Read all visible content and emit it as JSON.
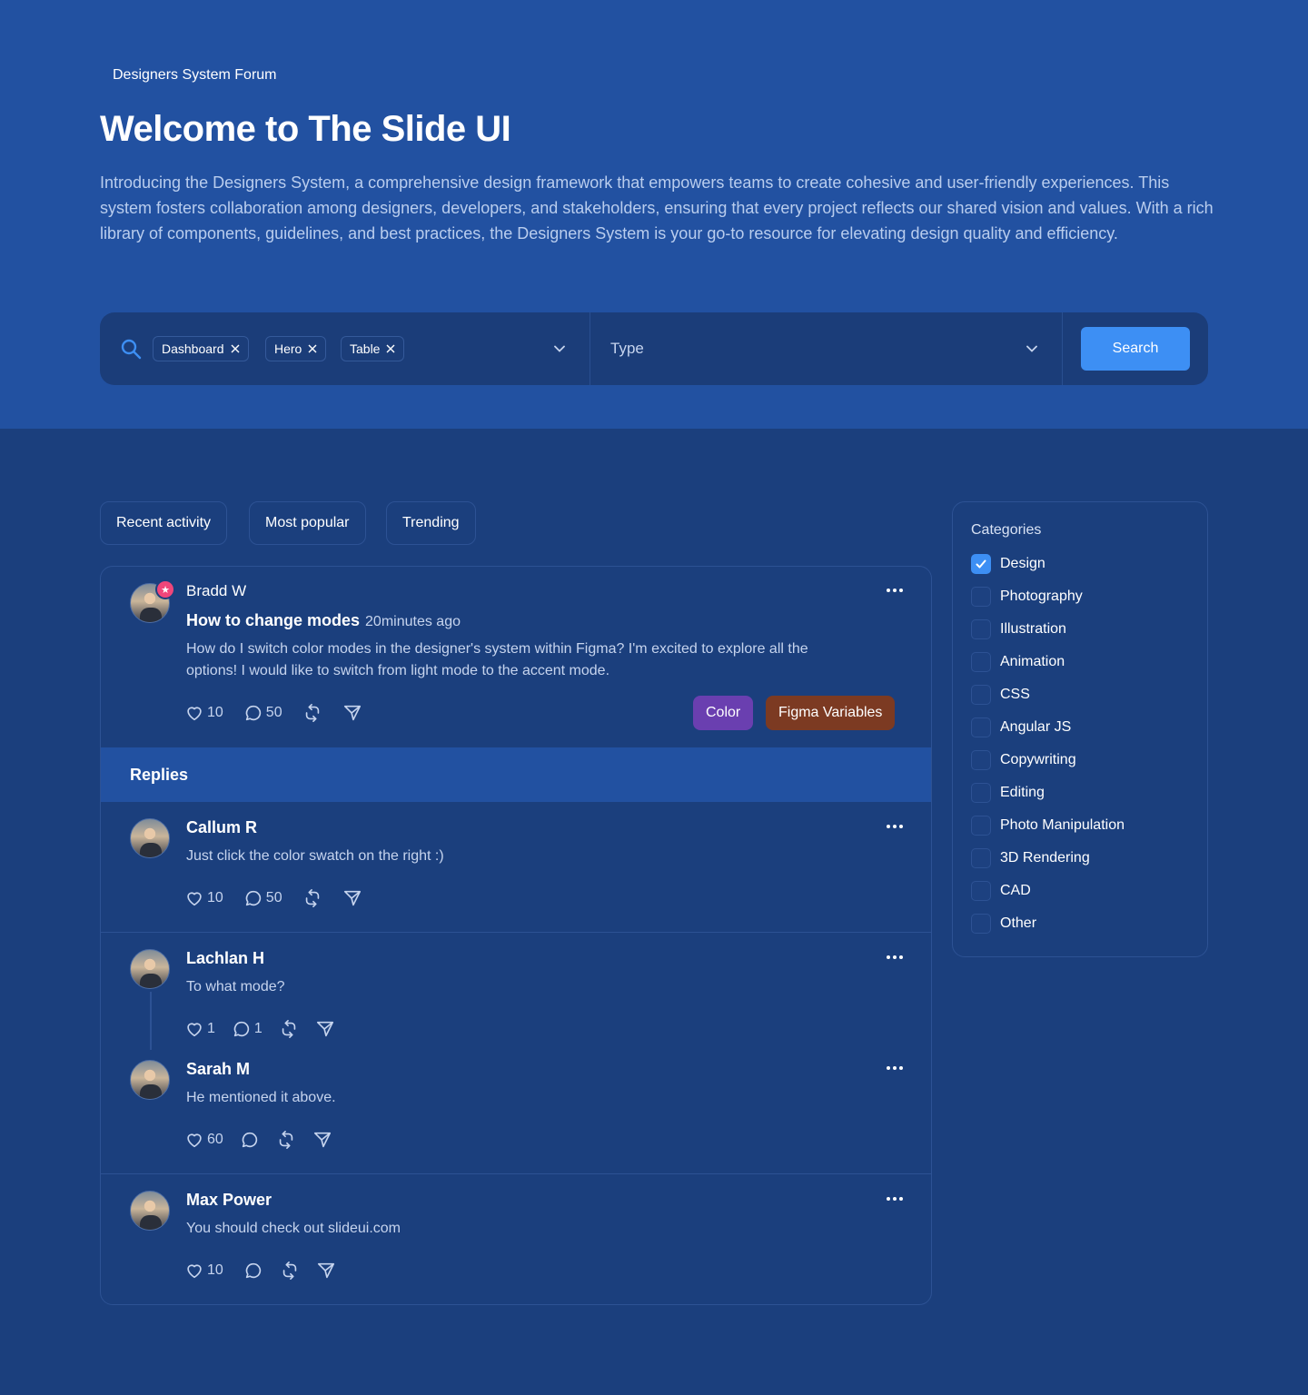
{
  "header": {
    "eyebrow": "Designers System Forum",
    "title": "Welcome to The Slide UI",
    "description": "Introducing the Designers System, a comprehensive design framework that empowers teams to create cohesive and user-friendly experiences. This system fosters collaboration among designers, developers, and stakeholders, ensuring that every project reflects our shared vision and values. With a rich library of components, guidelines, and best practices, the Designers System is your go-to resource for elevating design quality and efficiency."
  },
  "search": {
    "chips": [
      "Dashboard",
      "Hero",
      "Table"
    ],
    "type_label": "Type",
    "button_label": "Search"
  },
  "tabs": [
    "Recent activity",
    "Most popular",
    "Trending"
  ],
  "post": {
    "author": "Bradd W",
    "title": "How to change modes",
    "time": "20minutes ago",
    "body": "How do I switch color modes in the designer's system within Figma? I'm excited to explore all the options! I would like to switch from light mode to the accent mode.",
    "likes": "10",
    "comments": "50",
    "tags": [
      {
        "label": "Color",
        "color": "#6a3fb0"
      },
      {
        "label": "Figma Variables",
        "color": "#7c3a22"
      }
    ]
  },
  "replies_label": "Replies",
  "replies": [
    {
      "author": "Callum R",
      "body": "Just click the color swatch on the right :)",
      "likes": "10",
      "comments": "50"
    },
    {
      "author": "Lachlan H",
      "body": "To what mode?",
      "likes": "1",
      "comments": "1"
    },
    {
      "author": "Sarah M",
      "body": "He mentioned it above.",
      "likes": "60",
      "comments": ""
    },
    {
      "author": "Max Power",
      "body": "You should check out slideui.com",
      "likes": "10",
      "comments": ""
    }
  ],
  "categories": {
    "title": "Categories",
    "items": [
      {
        "label": "Design",
        "checked": true
      },
      {
        "label": "Photography",
        "checked": false
      },
      {
        "label": "Illustration",
        "checked": false
      },
      {
        "label": "Animation",
        "checked": false
      },
      {
        "label": "CSS",
        "checked": false
      },
      {
        "label": "Angular JS",
        "checked": false
      },
      {
        "label": "Copywriting",
        "checked": false
      },
      {
        "label": "Editing",
        "checked": false
      },
      {
        "label": "Photo Manipulation",
        "checked": false
      },
      {
        "label": "3D Rendering",
        "checked": false
      },
      {
        "label": "CAD",
        "checked": false
      },
      {
        "label": "Other",
        "checked": false
      }
    ]
  },
  "colors": {
    "accent": "#3d8ff4",
    "hero_bg": "#2251a1",
    "page_bg": "#1b3f7d"
  }
}
